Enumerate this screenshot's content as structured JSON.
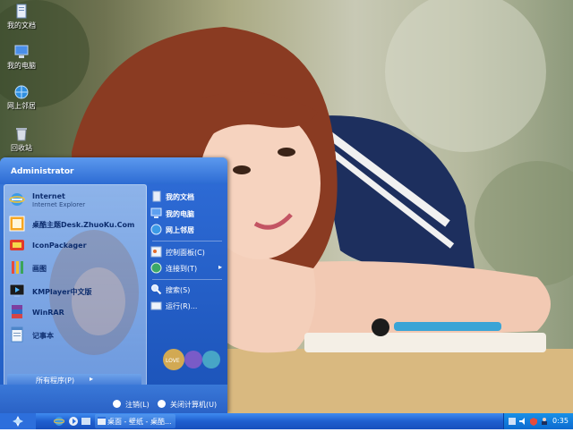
{
  "desktop": {
    "icons": [
      {
        "label": "我的文档",
        "icon": "documents-icon"
      },
      {
        "label": "我的电脑",
        "icon": "computer-icon"
      },
      {
        "label": "网上邻居",
        "icon": "network-icon"
      },
      {
        "label": "回收站",
        "icon": "recycle-bin-icon"
      }
    ]
  },
  "start_menu": {
    "user": "Administrator",
    "pinned": [
      {
        "title": "Internet",
        "subtitle": "Internet Explorer",
        "icon": "internet-explorer-icon"
      },
      {
        "title": "桌酷主题Desk.ZhuoKu.Com",
        "icon": "theme-icon"
      },
      {
        "title": "IconPackager",
        "icon": "iconpackager-icon"
      },
      {
        "title": "画图",
        "icon": "paint-icon"
      },
      {
        "title": "KMPlayer中文版",
        "icon": "kmplayer-icon"
      },
      {
        "title": "WinRAR",
        "icon": "winrar-icon"
      },
      {
        "title": "记事本",
        "icon": "notepad-icon"
      }
    ],
    "all_programs": "所有程序(P)",
    "right": [
      {
        "label": "我的文档",
        "icon": "documents-icon"
      },
      {
        "label": "我的电脑",
        "icon": "computer-icon"
      },
      {
        "label": "网上邻居",
        "icon": "network-icon"
      },
      {
        "label": "控制面板(C)",
        "icon": "control-panel-icon"
      },
      {
        "label": "连接到(T)",
        "icon": "connect-icon"
      },
      {
        "label": "搜索(S)",
        "icon": "search-icon"
      },
      {
        "label": "运行(R)...",
        "icon": "run-icon"
      }
    ],
    "logo_text": "LOVE",
    "logoff": "注销(L)",
    "shutdown": "关闭计算机(U)"
  },
  "taskbar": {
    "task": "桌面 - 壁纸 - 桌酷...",
    "clock": "0:35"
  },
  "colors": {
    "taskbar": "#1f5fcf",
    "start_menu": "#2c6bd3"
  }
}
